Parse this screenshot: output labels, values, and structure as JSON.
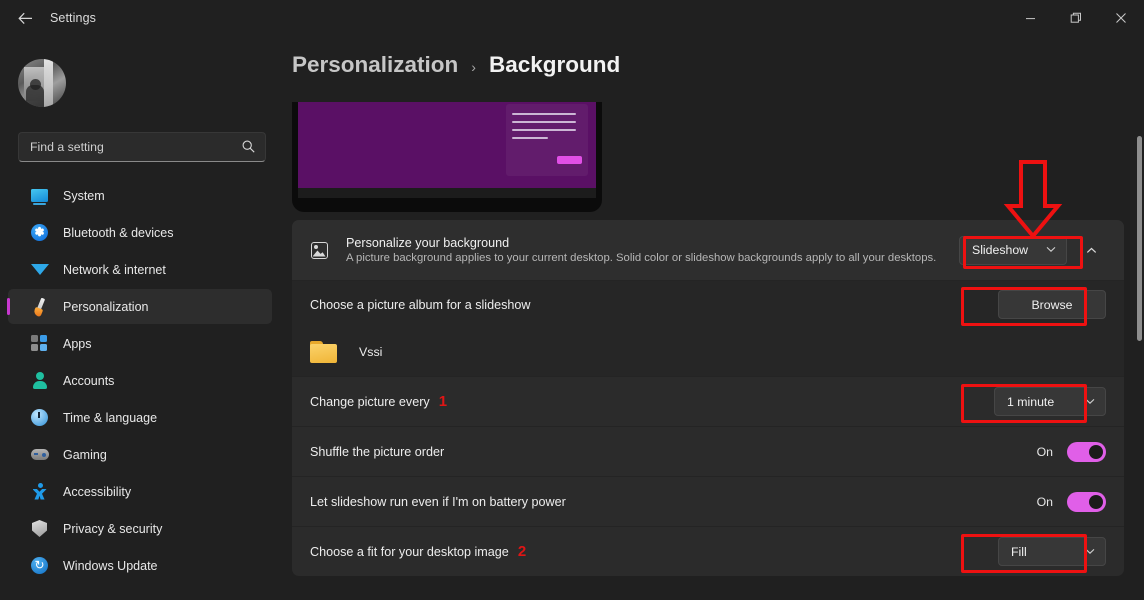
{
  "window": {
    "title": "Settings",
    "back_icon": "arrow-left-icon",
    "controls": {
      "minimize": "─",
      "restore": "❐",
      "close": "✕"
    }
  },
  "sidebar": {
    "search": {
      "placeholder": "Find a setting",
      "icon": "search-icon"
    },
    "items": [
      {
        "label": "System",
        "icon": "monitor-icon"
      },
      {
        "label": "Bluetooth & devices",
        "icon": "bluetooth-icon"
      },
      {
        "label": "Network & internet",
        "icon": "wifi-icon"
      },
      {
        "label": "Personalization",
        "icon": "paintbrush-icon"
      },
      {
        "label": "Apps",
        "icon": "apps-grid-icon"
      },
      {
        "label": "Accounts",
        "icon": "account-person-icon"
      },
      {
        "label": "Time & language",
        "icon": "clock-icon"
      },
      {
        "label": "Gaming",
        "icon": "gamepad-icon"
      },
      {
        "label": "Accessibility",
        "icon": "accessibility-person-icon"
      },
      {
        "label": "Privacy & security",
        "icon": "shield-icon"
      },
      {
        "label": "Windows Update",
        "icon": "refresh-circle-icon"
      }
    ],
    "active_index": 3
  },
  "breadcrumb": {
    "parent": "Personalization",
    "separator": "›",
    "current": "Background"
  },
  "preview": {
    "name": "desktop-wallpaper-preview"
  },
  "settings": {
    "header": {
      "icon": "image-icon",
      "title": "Personalize your background",
      "description": "A picture background applies to your current desktop. Solid color or slideshow backgrounds apply to all your desktops.",
      "dropdown_value": "Slideshow",
      "chevron": "⌄",
      "expand_chevron": "⌃"
    },
    "rows": [
      {
        "label": "Choose a picture album for a slideshow",
        "button": "Browse",
        "folder": {
          "name": "Vssi",
          "icon": "folder-icon"
        }
      },
      {
        "label": "Change picture every",
        "annotation": "1",
        "dropdown_value": "1 minute",
        "chevron": "⌄"
      },
      {
        "label": "Shuffle the picture order",
        "toggle_state": "On",
        "toggle_on": true
      },
      {
        "label": "Let slideshow run even if I'm on battery power",
        "toggle_state": "On",
        "toggle_on": true
      },
      {
        "label": "Choose a fit for your desktop image",
        "annotation": "2",
        "dropdown_value": "Fill",
        "chevron": "⌄"
      }
    ]
  },
  "annotations": {
    "accent_red": "#ee1111",
    "arrow_target": "Slideshow",
    "highlighted": [
      "Slideshow dropdown",
      "Browse button",
      "1 minute dropdown",
      "Fill dropdown"
    ]
  },
  "colors": {
    "window_bg": "#202020",
    "card_bg": "#2b2b2b",
    "accent_magenta": "#c838d0",
    "toggle_on": "#e05fe8",
    "wallpaper_purple": "#5a1065"
  }
}
